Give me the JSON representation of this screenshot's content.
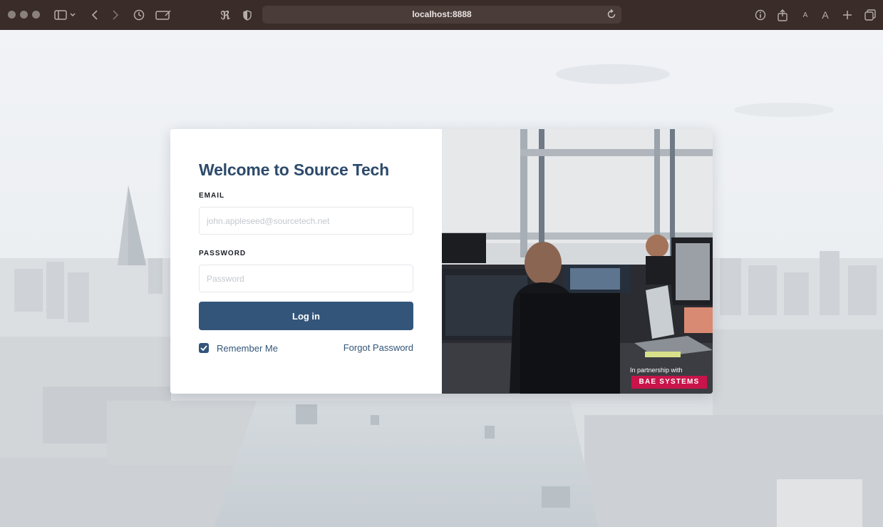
{
  "browser": {
    "url": "localhost:8888",
    "icons": {
      "sidebar": "sidebar-icon",
      "back": "chevron-left-icon",
      "forward": "chevron-right-icon",
      "history": "clock-icon",
      "reader": "reader-icon",
      "extension": "extension-icon",
      "shield": "shield-icon",
      "reload": "reload-icon",
      "info": "info-icon",
      "share": "share-icon",
      "text_smaller": "A",
      "text_larger": "A",
      "new_tab": "plus-icon",
      "tabs": "tabs-overview-icon"
    }
  },
  "login": {
    "title": "Welcome to Source Tech",
    "email": {
      "label": "EMAIL",
      "placeholder": "john.appleseed@sourcetech.net",
      "value": ""
    },
    "password": {
      "label": "PASSWORD",
      "placeholder": "Password",
      "value": ""
    },
    "submit_label": "Log in",
    "remember": {
      "label": "Remember Me",
      "checked": true
    },
    "forgot_label": "Forgot Password"
  },
  "promo": {
    "partner_text": "In partnership with",
    "logo_text": "BAE SYSTEMS"
  },
  "colors": {
    "toolbar": "#3a2c29",
    "primary": "#33557a",
    "title": "#2d4a6b",
    "logo": "#c8144a"
  }
}
